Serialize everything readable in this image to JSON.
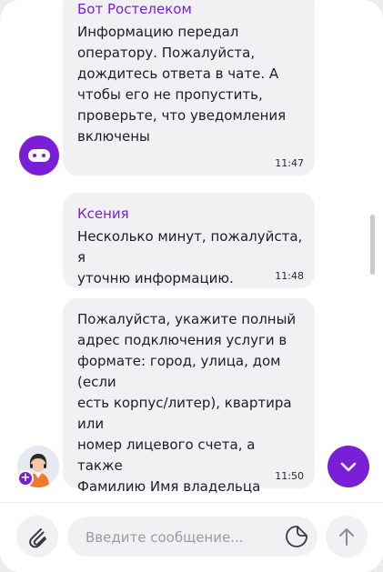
{
  "messages": [
    {
      "sender": "Бот Ростелеком",
      "text": "Информацию передал\nоператору. Пожалуйста,\nдождитесь ответа в чате. А\nчтобы его не пропустить,\nпроверьте, что уведомления\nвключены",
      "time": "11:47"
    },
    {
      "sender": "Ксения",
      "text": "Несколько минут, пожалуйста, я\nуточню информацию.",
      "time": "11:48"
    },
    {
      "sender": "",
      "text": "Пожалуйста, укажите полный\nадрес подключения услуги в\nформате: город, улица, дом (если\nесть корпус/литер), квартира или\nномер лицевого счета, а также\nФамилию Имя владельца\nдоговора.",
      "time": "11:50"
    }
  ],
  "composer": {
    "placeholder": "Введите сообщение...",
    "value": ""
  },
  "icons": {
    "bot_avatar": "robot-avatar-icon",
    "operator_avatar": "operator-avatar",
    "attach": "paperclip-icon",
    "sticker": "sticker-icon",
    "send": "arrow-up-icon",
    "scroll_down": "chevron-down-icon"
  },
  "colors": {
    "accent": "#7b1fd6",
    "bubble": "#f1f1f4",
    "text": "#1d1d22"
  }
}
